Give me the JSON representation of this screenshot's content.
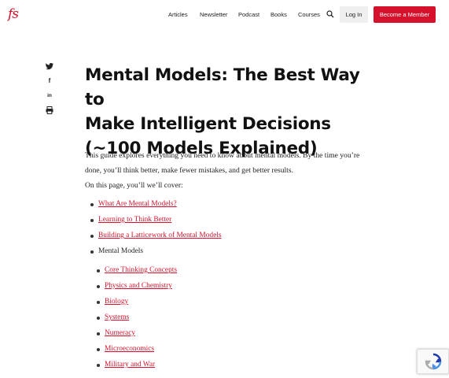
{
  "brand": {
    "logo": "fs",
    "accent_color": "#d6112c"
  },
  "nav": {
    "items": [
      "Articles",
      "Newsletter",
      "Podcast",
      "Books",
      "Courses"
    ],
    "search_icon": "search-icon",
    "login_label": "Log In",
    "member_label": "Become a Member"
  },
  "share": {
    "icons": [
      "twitter-icon",
      "facebook-icon",
      "linkedin-icon",
      "print-icon"
    ],
    "glyphs": [
      "🐦",
      "f",
      "in",
      "⎙"
    ]
  },
  "article": {
    "title_lines": [
      "Mental Models: The Best Way to",
      "Make Intelligent Decisions",
      "(~100 Models Explained)"
    ],
    "intro": "This guide explores everything you need to know about mental models. By the time you’re done, you’ll think better, make fewer mistakes, and get better results.",
    "cover_label": "On this page, you’ll we’ll cover:",
    "toc": [
      "What Are Mental Models?",
      "Learning to Think Better",
      "Building a Latticework of Mental Models",
      "Mental Models"
    ],
    "subtoc": [
      "Core Thinking Concepts",
      "Physics and Chemistry",
      "Biology",
      "Systems",
      "Numeracy",
      "Microeconomics",
      "Military and War"
    ]
  }
}
